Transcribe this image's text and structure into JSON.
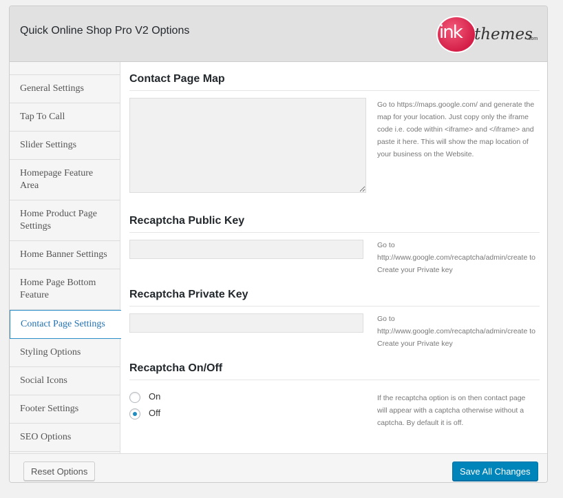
{
  "header": {
    "title": "Quick Online Shop Pro V2 Options",
    "logo": {
      "ink": "ink",
      "themes": "themes",
      "com": ".com"
    }
  },
  "sidebar": {
    "items": [
      {
        "label": "General Settings"
      },
      {
        "label": "Tap To Call"
      },
      {
        "label": "Slider Settings"
      },
      {
        "label": "Homepage Feature Area"
      },
      {
        "label": "Home Product Page Settings"
      },
      {
        "label": "Home Banner Settings"
      },
      {
        "label": "Home Page Bottom Feature"
      },
      {
        "label": "Contact Page Settings",
        "active": true
      },
      {
        "label": "Styling Options"
      },
      {
        "label": "Social Icons"
      },
      {
        "label": "Footer Settings"
      },
      {
        "label": "SEO Options"
      }
    ]
  },
  "content": {
    "map": {
      "title": "Contact Page Map",
      "value": "",
      "help": "Go to https://maps.google.com/ and generate the map for your location. Just copy only the iframe code i.e. code within <iframe> and </iframe> and paste it here. This will show the map location of your business on the Website."
    },
    "public_key": {
      "title": "Recaptcha Public Key",
      "value": "",
      "help": "Go to http://www.google.com/recaptcha/admin/create to Create your Private key"
    },
    "private_key": {
      "title": "Recaptcha Private Key",
      "value": "",
      "help": "Go to http://www.google.com/recaptcha/admin/create to Create your Private key"
    },
    "recaptcha_toggle": {
      "title": "Recaptcha On/Off",
      "options": [
        "On",
        "Off"
      ],
      "selected": "Off",
      "help": "If the recaptcha option is on then contact page will appear with a captcha otherwise without a captcha. By default it is off."
    }
  },
  "footer": {
    "reset_label": "Reset Options",
    "save_label": "Save All Changes"
  },
  "colors": {
    "accent": "#0085ba",
    "active_border": "#2a8cc7",
    "logo_pink": "#d41f48"
  }
}
